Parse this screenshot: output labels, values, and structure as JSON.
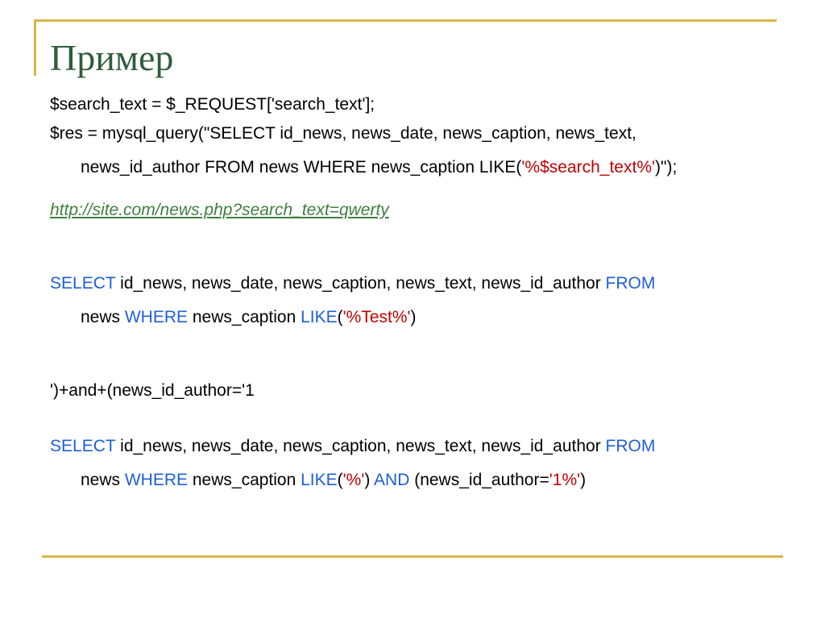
{
  "title": "Пример",
  "colors": {
    "accent": "#d6b64a",
    "title": "#2f5d3a",
    "keyword": "#1f5fd6",
    "string": "#c00000",
    "link": "#3f7f3f"
  },
  "php_code": {
    "line1": "$search_text = $_REQUEST['search_text'];",
    "line2": "$res = mysql_query(\"SELECT id_news, news_date, news_caption, news_text,",
    "line3_a": "news_id_author FROM news WHERE news_caption LIKE(",
    "line3_str": "'%$search_text%'",
    "line3_b": ")\");"
  },
  "example_url": "http://site.com/news.php?search_text=qwerty",
  "query1": {
    "kw_select": "SELECT",
    "cols": " id_news, news_date, news_caption, news_text, news_id_author ",
    "kw_from": "FROM",
    "table": "news ",
    "kw_where": "WHERE",
    "cond": " news_caption ",
    "kw_like": "LIKE",
    "open": "(",
    "str": "'%Test%'",
    "close": ")"
  },
  "injection_payload": "')+and+(news_id_author='1",
  "query2": {
    "kw_select": "SELECT",
    "cols": " id_news, news_date, news_caption, news_text, news_id_author ",
    "kw_from": "FROM",
    "table": "news ",
    "kw_where": "WHERE",
    "cond": " news_caption ",
    "kw_like": "LIKE",
    "open": "(",
    "str1": "'%'",
    "mid1": ") ",
    "kw_and": "AND",
    "mid2": " (news_id_author=",
    "str2": "'1%'",
    "close": ")"
  }
}
